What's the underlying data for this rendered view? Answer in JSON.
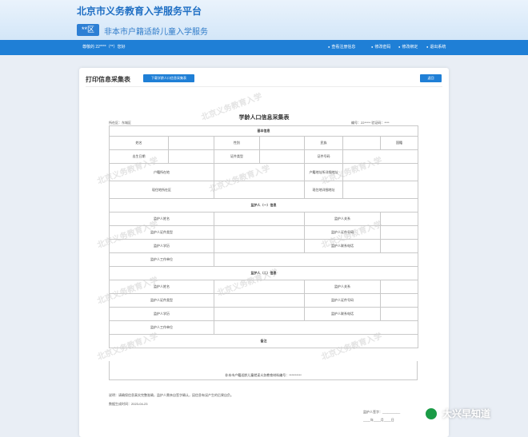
{
  "header": {
    "title": "北京市义务教育入学服务平台",
    "region": "**区",
    "subtitle": "非本市户籍适龄儿童入学服务"
  },
  "navbar": {
    "user": "尊敬的 22****（**）您好",
    "items": [
      "查看注册信息",
      "修改密码",
      "修改绑定",
      "退出系统"
    ]
  },
  "panel": {
    "title": "打印信息采集表",
    "download_button": "下载学龄人口信息采集表",
    "back_button": "返回"
  },
  "form": {
    "title": "学龄人口信息采集表",
    "district": "所在区：东城区",
    "code": "编号：22*****  验证码：****",
    "basic_section": "基本信息",
    "name": "姓名",
    "gender": "性别",
    "ethnicity": "民族",
    "nationality": "国籍",
    "birth_date": "出生日期",
    "id_type": "证件类型",
    "id_number": "证件号码",
    "hukou": "户籍所在地",
    "hukou_address": "户籍地址所详细地址",
    "residence": "现住地所在区",
    "residence_address": "现住地详细地址",
    "guardian1_section": "监护人（一）信息",
    "guardian2_section": "监护人（二）信息",
    "g_name": "监护人姓名",
    "g_relation": "监护人关系",
    "g_id_type": "监护人证件类型",
    "g_id_number": "监护人证件号码",
    "g_education": "监护人学历",
    "g_phone": "监护人联系电话",
    "g_employer": "监护人工作单位",
    "remark": "备注",
    "note": "非本市户籍适龄儿童就读义务教育材料编号：**********"
  },
  "footer": {
    "note": "说明：请确保信息真实完整准确，监护人需亲自签字确认，因信息有误产生的后果自负。",
    "date": "数据生成时间：2023-04-23",
    "signature": "监护人签字：__________",
    "date_line": "____年____月____日"
  },
  "watermark": "北京义务教育入学",
  "brand": "大兴早知道"
}
